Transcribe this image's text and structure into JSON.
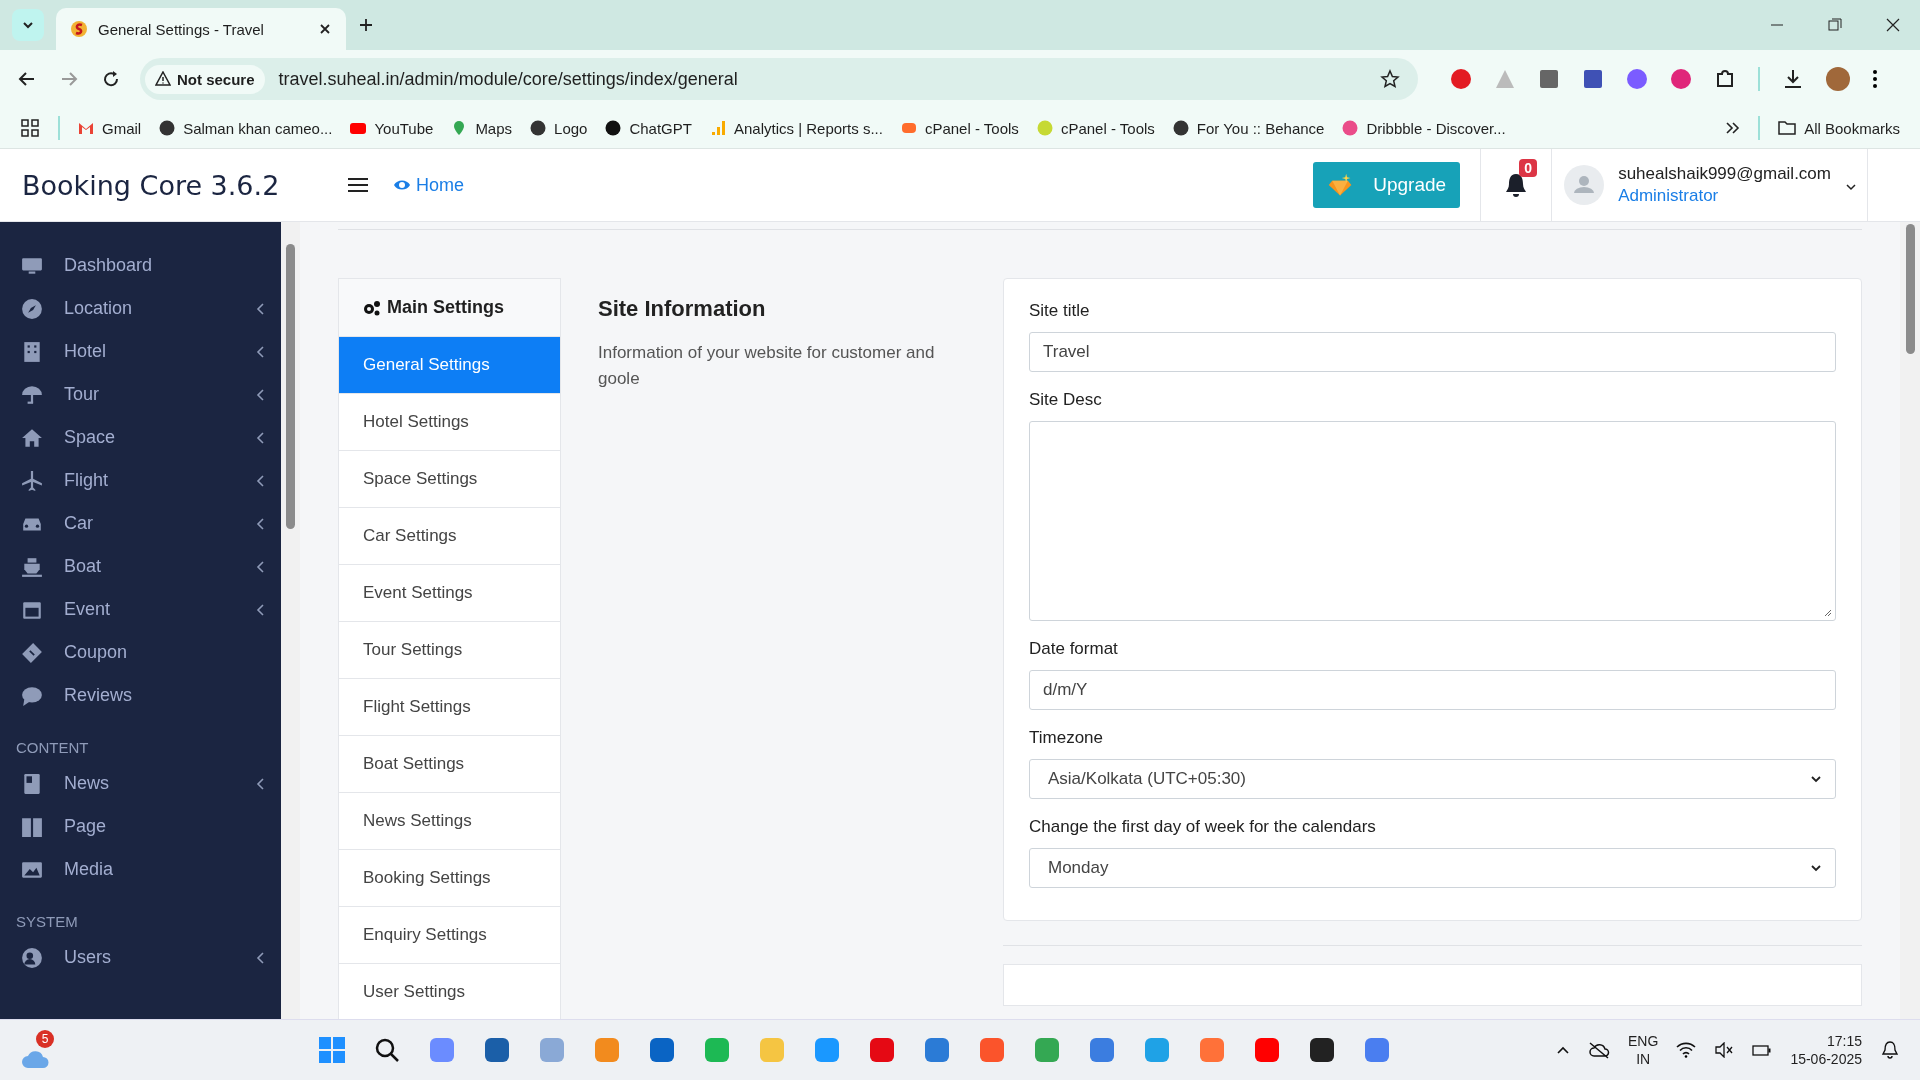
{
  "browser": {
    "tab_title": "General Settings - Travel",
    "security_label": "Not secure",
    "url": "travel.suheal.in/admin/module/core/settings/index/general",
    "bookmarks": [
      {
        "label": "Gmail"
      },
      {
        "label": "Salman khan cameo..."
      },
      {
        "label": "YouTube"
      },
      {
        "label": "Maps"
      },
      {
        "label": "Logo"
      },
      {
        "label": "ChatGPT"
      },
      {
        "label": "Analytics | Reports s..."
      },
      {
        "label": "cPanel - Tools"
      },
      {
        "label": "cPanel - Tools"
      },
      {
        "label": "For You :: Behance"
      },
      {
        "label": "Dribbble - Discover..."
      }
    ],
    "all_bookmarks": "All Bookmarks"
  },
  "header": {
    "brand": "Booking Core 3.6.2",
    "home_link": "Home",
    "upgrade_button": "Upgrade",
    "notification_count": "0",
    "user_email": "suhealshaik999@gmail.com",
    "user_role": "Administrator"
  },
  "sidebar": {
    "sections": [
      {
        "items": [
          {
            "label": "Dashboard",
            "has_submenu": false
          },
          {
            "label": "Location",
            "has_submenu": true
          },
          {
            "label": "Hotel",
            "has_submenu": true
          },
          {
            "label": "Tour",
            "has_submenu": true
          },
          {
            "label": "Space",
            "has_submenu": true
          },
          {
            "label": "Flight",
            "has_submenu": true
          },
          {
            "label": "Car",
            "has_submenu": true
          },
          {
            "label": "Boat",
            "has_submenu": true
          },
          {
            "label": "Event",
            "has_submenu": true
          },
          {
            "label": "Coupon",
            "has_submenu": false
          },
          {
            "label": "Reviews",
            "has_submenu": false
          }
        ]
      },
      {
        "heading": "CONTENT",
        "items": [
          {
            "label": "News",
            "has_submenu": true
          },
          {
            "label": "Page",
            "has_submenu": false
          },
          {
            "label": "Media",
            "has_submenu": false
          }
        ]
      },
      {
        "heading": "SYSTEM",
        "items": [
          {
            "label": "Users",
            "has_submenu": true
          }
        ]
      }
    ]
  },
  "settings_menu": {
    "heading": "Main Settings",
    "items": [
      {
        "label": "General Settings",
        "selected": true
      },
      {
        "label": "Hotel Settings",
        "selected": false
      },
      {
        "label": "Space Settings",
        "selected": false
      },
      {
        "label": "Car Settings",
        "selected": false
      },
      {
        "label": "Event Settings",
        "selected": false
      },
      {
        "label": "Tour Settings",
        "selected": false
      },
      {
        "label": "Flight Settings",
        "selected": false
      },
      {
        "label": "Boat Settings",
        "selected": false
      },
      {
        "label": "News Settings",
        "selected": false
      },
      {
        "label": "Booking Settings",
        "selected": false
      },
      {
        "label": "Enquiry Settings",
        "selected": false
      },
      {
        "label": "User Settings",
        "selected": false
      }
    ]
  },
  "section": {
    "title": "Site Information",
    "description": "Information of your website for customer and goole"
  },
  "form_fields": [
    {
      "label": "Site title",
      "kind": "text",
      "value": "Travel"
    },
    {
      "label": "Site Desc",
      "kind": "textarea"
    },
    {
      "label": "Date format",
      "kind": "text",
      "value": "d/m/Y"
    },
    {
      "label": "Timezone",
      "kind": "select",
      "value": "Asia/Kolkata (UTC+05:30)"
    },
    {
      "label": "Change the first day of week for the calendars",
      "kind": "select",
      "value": "Monday"
    }
  ],
  "taskbar": {
    "weather_badge": "5",
    "language": "ENG",
    "region": "IN",
    "time": "17:15",
    "date": "15-06-2025"
  }
}
